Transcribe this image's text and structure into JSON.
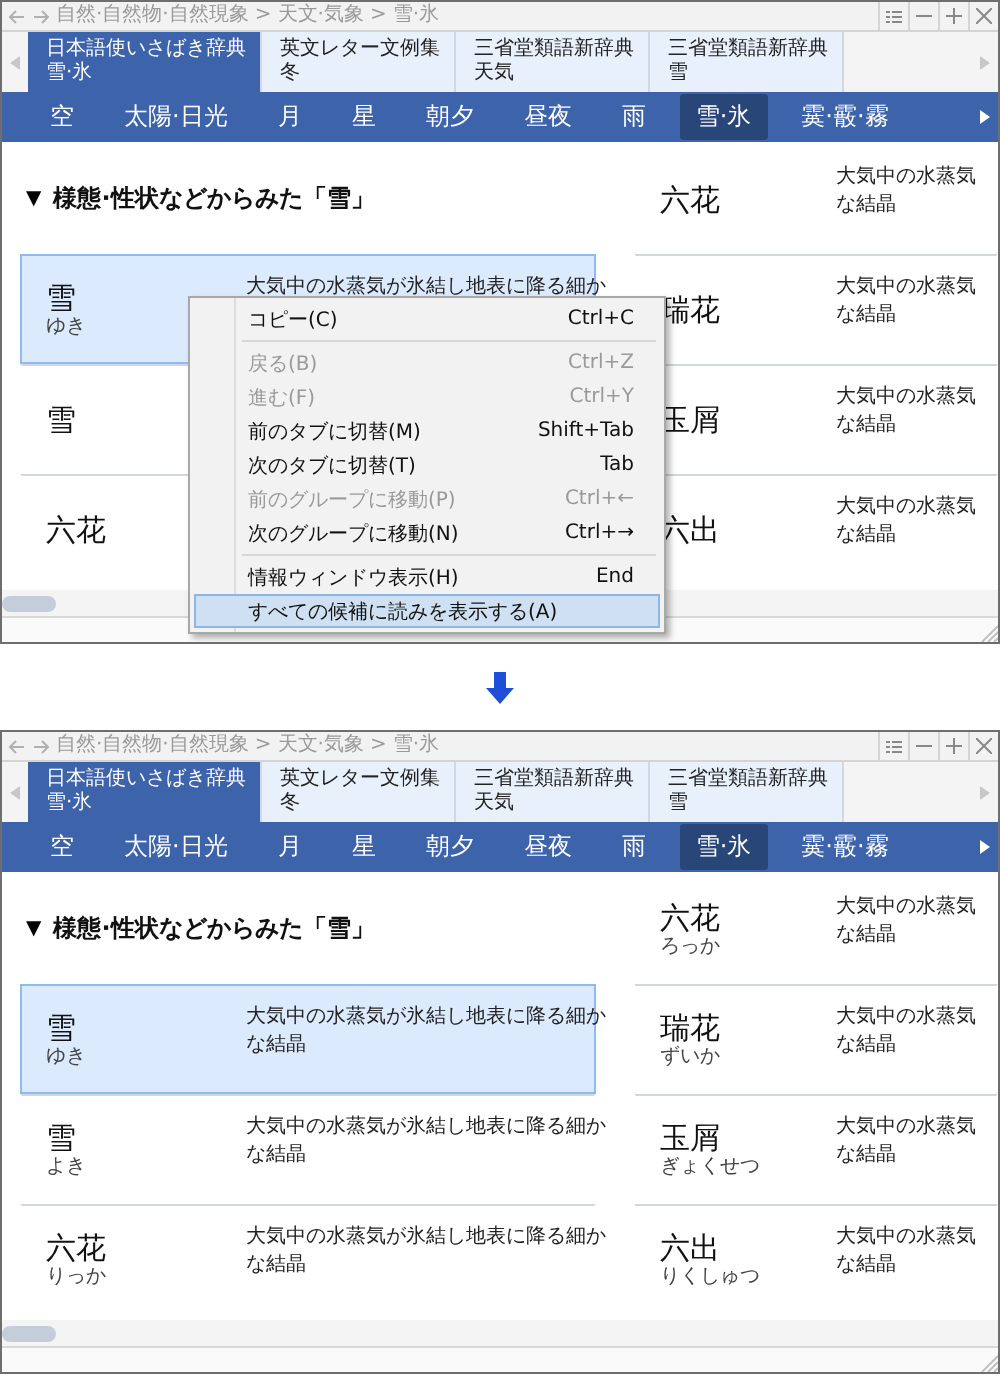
{
  "screens": [
    {
      "breadcrumb": [
        "自然·自然物·自然現象",
        "天文·気象",
        "雪·氷"
      ],
      "separator": ">",
      "dict_tabs": [
        {
          "title": "日本語使いさばき辞典",
          "subtitle": "雪·氷",
          "selected": true
        },
        {
          "title": "英文レター文例集",
          "subtitle": "冬",
          "selected": false
        },
        {
          "title": "三省堂類語新辞典",
          "subtitle": "天気",
          "selected": false
        },
        {
          "title": "三省堂類語新辞典",
          "subtitle": "雪",
          "selected": false
        }
      ],
      "categories": [
        {
          "label": "空",
          "selected": false
        },
        {
          "label": "太陽·日光",
          "selected": false
        },
        {
          "label": "月",
          "selected": false
        },
        {
          "label": "星",
          "selected": false
        },
        {
          "label": "朝夕",
          "selected": false
        },
        {
          "label": "昼夜",
          "selected": false
        },
        {
          "label": "雨",
          "selected": false
        },
        {
          "label": "雪·氷",
          "selected": true
        },
        {
          "label": "霙·霰·霧",
          "selected": false
        }
      ],
      "section": {
        "marker": "▼",
        "title": "様態·性状などからみた「雪」"
      },
      "left_entries": [
        {
          "word": "雪",
          "reading": "ゆき",
          "lines": [
            "大気中の水蒸気が氷結し地表に降る細か"
          ],
          "selected": true
        },
        {
          "word": "雪",
          "selected": false
        },
        {
          "word": "六花",
          "selected": false
        }
      ],
      "right_entries": [
        {
          "word": "六花",
          "lines": [
            "大気中の水蒸気",
            "な結晶"
          ]
        },
        {
          "word": "瑞花",
          "lines": [
            "大気中の水蒸気",
            "な結晶"
          ]
        },
        {
          "word": "玉屑",
          "lines": [
            "大気中の水蒸気",
            "な結晶"
          ]
        },
        {
          "word": "六出",
          "lines": [
            "大気中の水蒸気",
            "な結晶"
          ]
        }
      ],
      "context_menu": {
        "items": [
          {
            "kind": "item",
            "label": "コピー(C)",
            "shortcut": "Ctrl+C",
            "disabled": false,
            "selected": false
          },
          {
            "kind": "separator"
          },
          {
            "kind": "item",
            "label": "戻る(B)",
            "shortcut": "Ctrl+Z",
            "disabled": true,
            "selected": false
          },
          {
            "kind": "item",
            "label": "進む(F)",
            "shortcut": "Ctrl+Y",
            "disabled": true,
            "selected": false
          },
          {
            "kind": "item",
            "label": "前のタブに切替(M)",
            "shortcut": "Shift+Tab",
            "disabled": false,
            "selected": false
          },
          {
            "kind": "item",
            "label": "次のタブに切替(T)",
            "shortcut": "Tab",
            "disabled": false,
            "selected": false
          },
          {
            "kind": "item",
            "label": "前のグループに移動(P)",
            "shortcut": "Ctrl+←",
            "disabled": true,
            "selected": false
          },
          {
            "kind": "item",
            "label": "次のグループに移動(N)",
            "shortcut": "Ctrl+→",
            "disabled": false,
            "selected": false
          },
          {
            "kind": "separator"
          },
          {
            "kind": "item",
            "label": "情報ウィンドウ表示(H)",
            "shortcut": "End",
            "disabled": false,
            "selected": false
          },
          {
            "kind": "item",
            "label": "すべての候補に読みを表示する(A)",
            "disabled": false,
            "selected": true
          }
        ]
      }
    },
    {
      "breadcrumb": [
        "自然·自然物·自然現象",
        "天文·気象",
        "雪·氷"
      ],
      "separator": ">",
      "dict_tabs": [
        {
          "title": "日本語使いさばき辞典",
          "subtitle": "雪·氷",
          "selected": true
        },
        {
          "title": "英文レター文例集",
          "subtitle": "冬",
          "selected": false
        },
        {
          "title": "三省堂類語新辞典",
          "subtitle": "天気",
          "selected": false
        },
        {
          "title": "三省堂類語新辞典",
          "subtitle": "雪",
          "selected": false
        }
      ],
      "categories": [
        {
          "label": "空",
          "selected": false
        },
        {
          "label": "太陽·日光",
          "selected": false
        },
        {
          "label": "月",
          "selected": false
        },
        {
          "label": "星",
          "selected": false
        },
        {
          "label": "朝夕",
          "selected": false
        },
        {
          "label": "昼夜",
          "selected": false
        },
        {
          "label": "雨",
          "selected": false
        },
        {
          "label": "雪·氷",
          "selected": true
        },
        {
          "label": "霙·霰·霧",
          "selected": false
        }
      ],
      "section": {
        "marker": "▼",
        "title": "様態·性状などからみた「雪」"
      },
      "left_entries": [
        {
          "word": "雪",
          "reading": "ゆき",
          "lines": [
            "大気中の水蒸気が氷結し地表に降る細か",
            "な結晶"
          ],
          "selected": true
        },
        {
          "word": "雪",
          "reading": "よき",
          "lines": [
            "大気中の水蒸気が氷結し地表に降る細か",
            "な結晶"
          ],
          "selected": false
        },
        {
          "word": "六花",
          "reading": "りっか",
          "lines": [
            "大気中の水蒸気が氷結し地表に降る細か",
            "な結晶"
          ],
          "selected": false
        }
      ],
      "right_entries": [
        {
          "word": "六花",
          "reading": "ろっか",
          "lines": [
            "大気中の水蒸気",
            "な結晶"
          ]
        },
        {
          "word": "瑞花",
          "reading": "ずいか",
          "lines": [
            "大気中の水蒸気",
            "な結晶"
          ]
        },
        {
          "word": "玉屑",
          "reading": "ぎょくせつ",
          "lines": [
            "大気中の水蒸気",
            "な結晶"
          ]
        },
        {
          "word": "六出",
          "reading": "りくしゅつ",
          "lines": [
            "大気中の水蒸気",
            "な結晶"
          ]
        }
      ]
    }
  ]
}
